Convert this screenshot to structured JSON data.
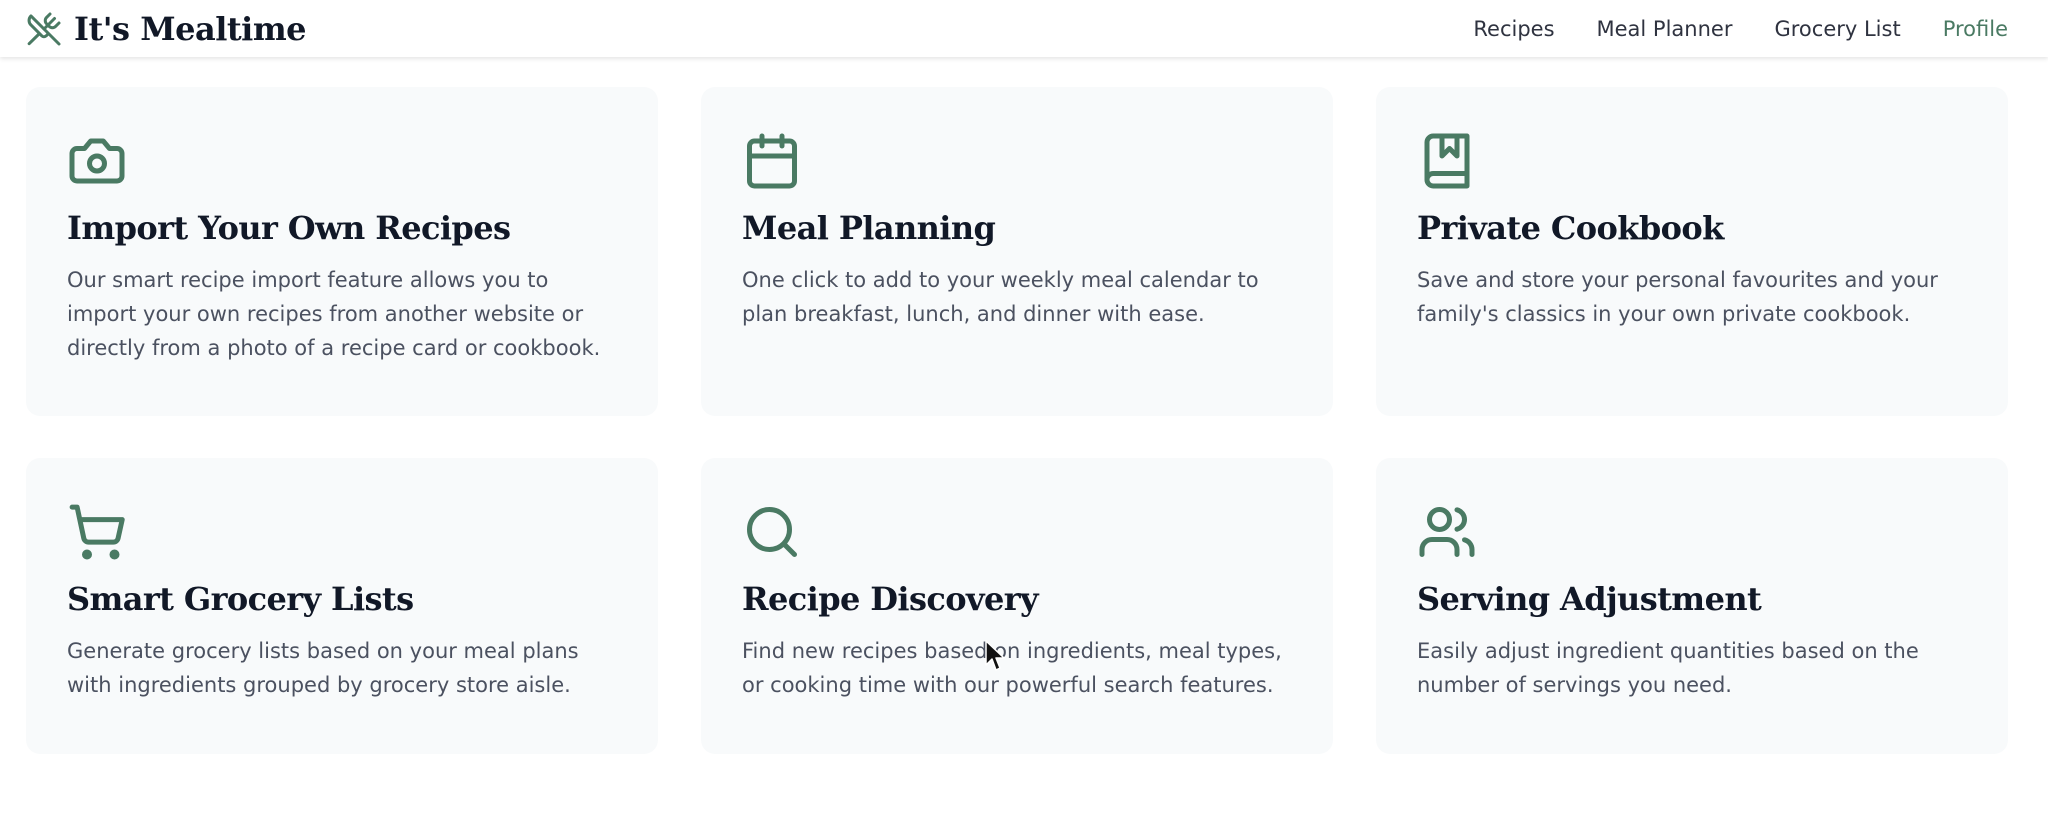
{
  "brand": {
    "name": "It's Mealtime",
    "icon": "utensils-crossed-icon"
  },
  "nav": {
    "links": [
      {
        "label": "Recipes"
      },
      {
        "label": "Meal Planner"
      },
      {
        "label": "Grocery List"
      },
      {
        "label": "Profile",
        "active": true
      }
    ]
  },
  "colors": {
    "accent": "#4a7a63",
    "card_bg": "#f8fafb",
    "text": "#111827",
    "muted_text": "#4b5160"
  },
  "features": [
    {
      "icon": "camera-icon",
      "title": "Import Your Own Recipes",
      "text": "Our smart recipe import feature allows you to import your own recipes from another website or directly from a photo of a recipe card or cookbook."
    },
    {
      "icon": "calendar-icon",
      "title": "Meal Planning",
      "text": "One click to add to your weekly meal calendar to plan breakfast, lunch, and dinner with ease."
    },
    {
      "icon": "book-bookmark-icon",
      "title": "Private Cookbook",
      "text": "Save and store your personal favourites and your family's classics in your own private cookbook."
    },
    {
      "icon": "shopping-cart-icon",
      "title": "Smart Grocery Lists",
      "text": "Generate grocery lists based on your meal plans with ingredients grouped by grocery store aisle."
    },
    {
      "icon": "search-icon",
      "title": "Recipe Discovery",
      "text": "Find new recipes based on ingredients, meal types, or cooking time with our powerful search features."
    },
    {
      "icon": "users-icon",
      "title": "Serving Adjustment",
      "text": "Easily adjust ingredient quantities based on the number of servings you need."
    }
  ]
}
